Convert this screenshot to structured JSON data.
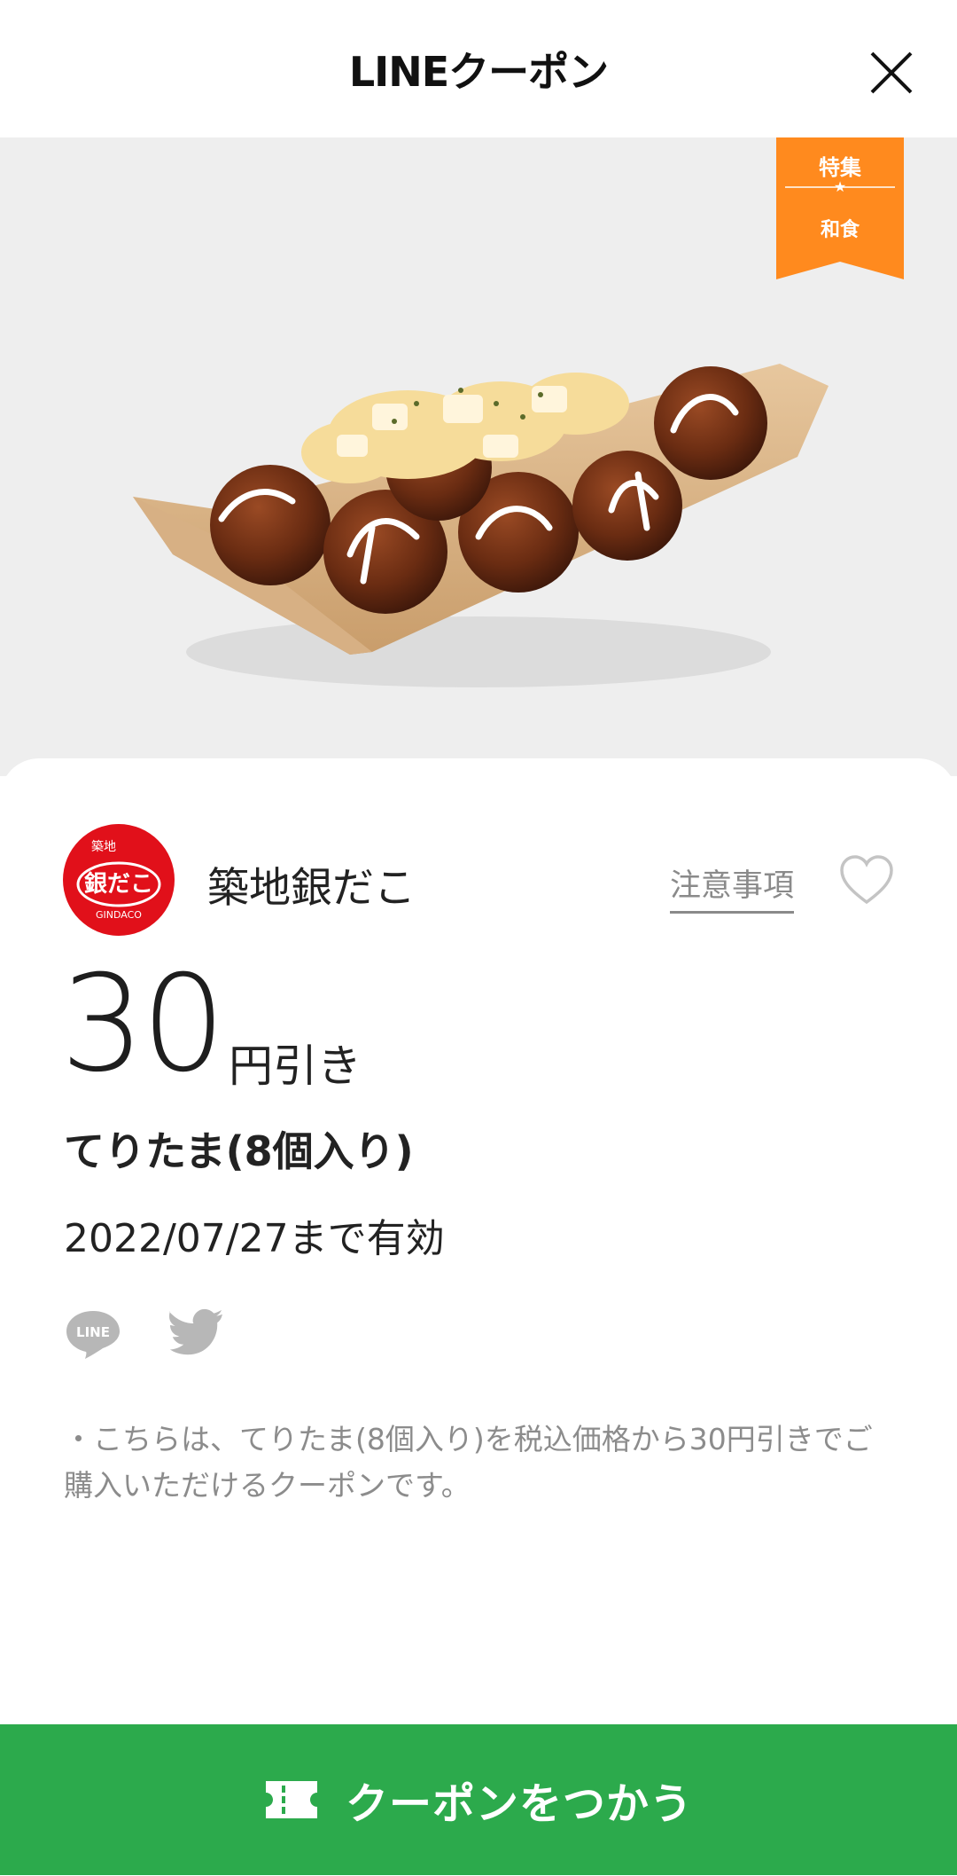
{
  "header": {
    "title": "LINEクーポン"
  },
  "hero": {
    "ribbon_top": "特集",
    "ribbon_star": "★",
    "ribbon_bottom": "和食"
  },
  "store": {
    "name": "築地銀だこ",
    "notice_label": "注意事項",
    "logo_text_top": "築地",
    "logo_text_main": "銀だこ",
    "logo_text_sub": "GINDACO"
  },
  "coupon": {
    "amount": "30",
    "unit": "円引き",
    "product": "てりたま(8個入り)",
    "expiry": "2022/07/27まで有効",
    "description": "・こちらは、てりたま(8個入り)を税込価格から30円引きでご購入いただけるクーポンです。"
  },
  "share": {
    "line_label": "LINE"
  },
  "footer": {
    "use_button_label": "クーポンをつかう"
  },
  "colors": {
    "accent_green": "#2caa4c",
    "ribbon_orange": "#ff8a1e",
    "logo_red": "#e1101a"
  }
}
